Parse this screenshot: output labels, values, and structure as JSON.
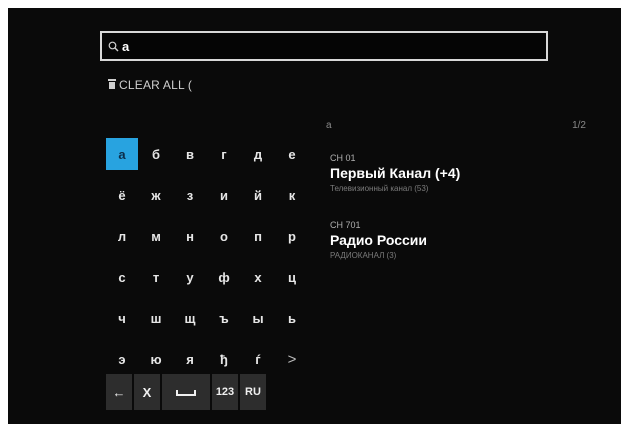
{
  "search": {
    "query": "a"
  },
  "clear_all": {
    "label": "CLEAR ALL ("
  },
  "keyboard": {
    "rows": [
      [
        "а",
        "б",
        "в",
        "г",
        "д",
        "е"
      ],
      [
        "ё",
        "ж",
        "з",
        "и",
        "й",
        "к"
      ],
      [
        "л",
        "м",
        "н",
        "о",
        "п",
        "р"
      ],
      [
        "с",
        "т",
        "у",
        "ф",
        "х",
        "ц"
      ],
      [
        "ч",
        "ш",
        "щ",
        "ъ",
        "ы",
        "ь"
      ],
      [
        "э",
        "ю",
        "я",
        "ђ",
        "ѓ",
        ">"
      ]
    ],
    "selected_key": "а",
    "bottom": {
      "backspace": "←",
      "clear": "X",
      "space": "⎵",
      "numbers": "123",
      "language": "RU"
    }
  },
  "results": {
    "query_label": "a",
    "page_indicator": "1/2",
    "channels": [
      {
        "number": "CH 01",
        "name": "Первый Канал (+4)",
        "description": "Телевизионный канал (53)"
      },
      {
        "number": "CH 701",
        "name": "Радио России",
        "description": "РАДИОКАНАЛ (3)"
      }
    ]
  },
  "colors": {
    "selected_key": "#28a3e0",
    "background": "#0a0a0a",
    "key_bg": "#2d2d2d"
  }
}
